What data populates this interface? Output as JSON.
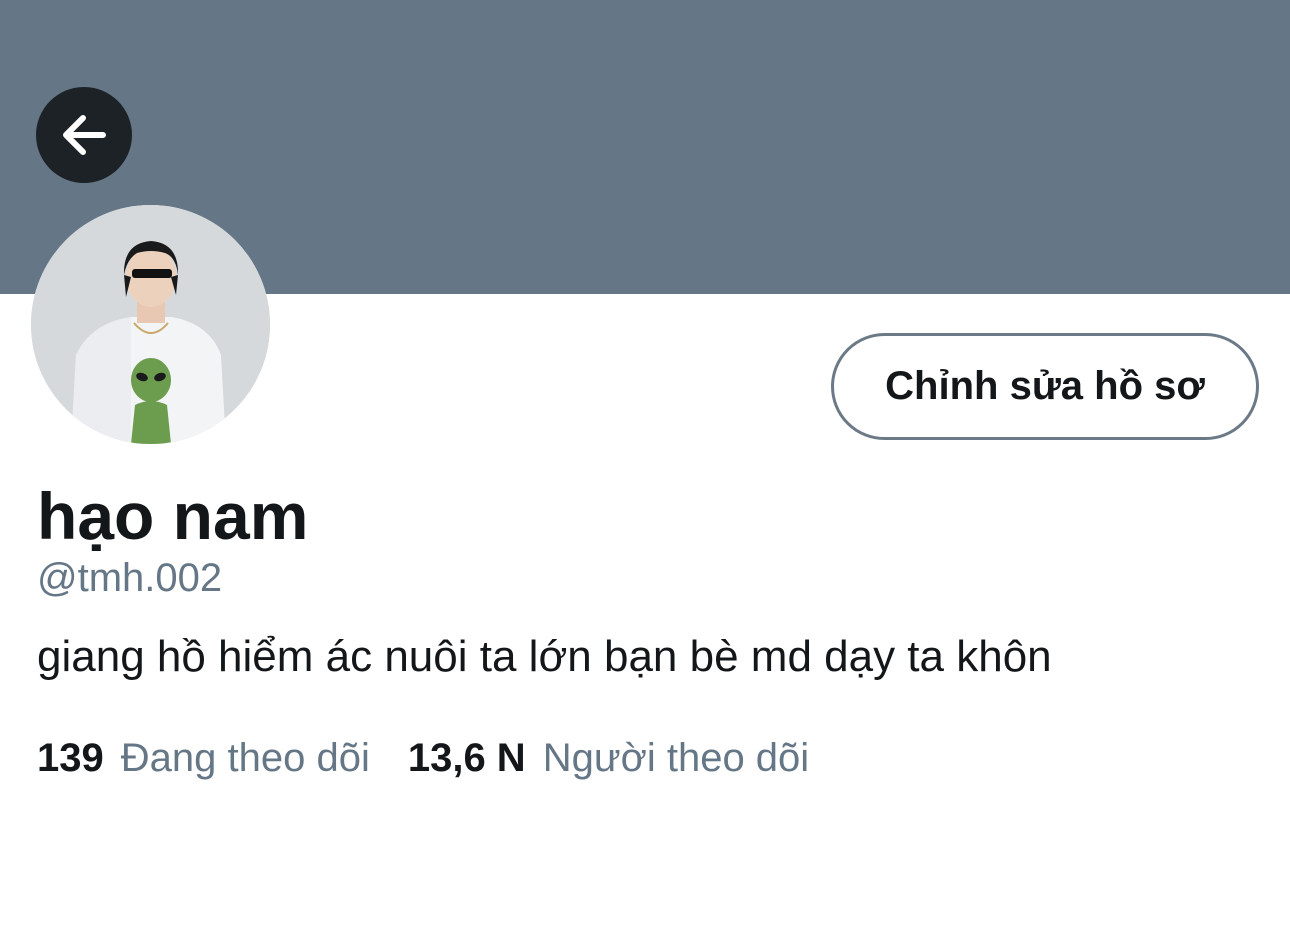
{
  "header": {
    "banner_color": "#657786",
    "back_icon": "arrow-left-icon"
  },
  "profile": {
    "avatar_alt": "hạo nam",
    "edit_label": "Chỉnh sửa hồ sơ",
    "display_name": "hạo nam",
    "handle": "@tmh.002",
    "bio": "giang hồ hiểm ác nuôi ta lớn bạn bè md dạy ta khôn"
  },
  "stats": {
    "following": {
      "count": "139",
      "label": "Đang theo dõi"
    },
    "followers": {
      "count": "13,6 N",
      "label": "Người theo dõi"
    }
  },
  "colors": {
    "text_primary": "#14171a",
    "text_secondary": "#657786",
    "button_border": "#6b7a86"
  }
}
